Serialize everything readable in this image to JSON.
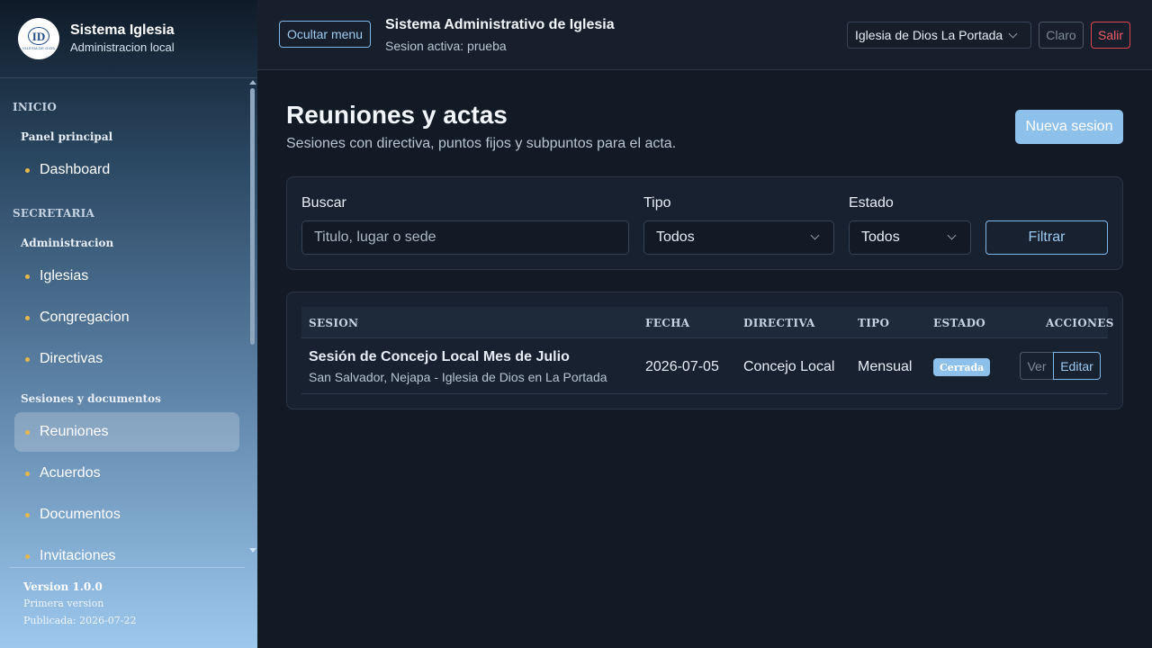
{
  "brand": {
    "logo_text": "ID",
    "logo_subtext": "IGLESIA DE DIOS",
    "title": "Sistema Iglesia",
    "subtitle": "Administracion local"
  },
  "sidebar": {
    "sections": [
      {
        "label": "INICIO"
      },
      {
        "label": "SECRETARIA"
      }
    ],
    "groups": [
      {
        "label": "Panel principal"
      },
      {
        "label": "Administracion"
      },
      {
        "label": "Sesiones y documentos"
      }
    ],
    "items": [
      {
        "label": "Dashboard",
        "active": false
      },
      {
        "label": "Iglesias",
        "active": false
      },
      {
        "label": "Congregacion",
        "active": false
      },
      {
        "label": "Directivas",
        "active": false
      },
      {
        "label": "Reuniones",
        "active": true
      },
      {
        "label": "Acuerdos",
        "active": false
      },
      {
        "label": "Documentos",
        "active": false
      },
      {
        "label": "Invitaciones",
        "active": false
      }
    ],
    "accent_dot_color": "#e6b84a"
  },
  "version": {
    "title": "Version 1.0.0",
    "line1": "Primera version",
    "line2": "Publicada: 2026-07-22"
  },
  "header": {
    "toggle_menu_label": "Ocultar menu",
    "title": "Sistema Administrativo de Iglesia",
    "session": "Sesion activa: prueba",
    "church_selected": "Iglesia de Dios La Portada",
    "theme_label": "Claro",
    "logout_label": "Salir"
  },
  "page": {
    "title": "Reuniones y actas",
    "subtitle": "Sesiones con directiva, puntos fijos y subpuntos para el acta.",
    "new_button": "Nueva sesion"
  },
  "filters": {
    "search_label": "Buscar",
    "search_placeholder": "Titulo, lugar o sede",
    "type_label": "Tipo",
    "type_value": "Todos",
    "status_label": "Estado",
    "status_value": "Todos",
    "filter_button": "Filtrar"
  },
  "table": {
    "columns": [
      "SESION",
      "FECHA",
      "DIRECTIVA",
      "TIPO",
      "ESTADO",
      "ACCIONES"
    ],
    "rows": [
      {
        "title": "Sesión de Concejo Local Mes de Julio",
        "place": "San Salvador, Nejapa - Iglesia de Dios en La Portada",
        "date": "2026-07-05",
        "board": "Concejo Local",
        "type": "Mensual",
        "status": "Cerrada",
        "view_label": "Ver",
        "edit_label": "Editar"
      }
    ]
  },
  "colors": {
    "primary": "#8ec0ec",
    "danger": "#e0444f",
    "background": "#111a25"
  }
}
